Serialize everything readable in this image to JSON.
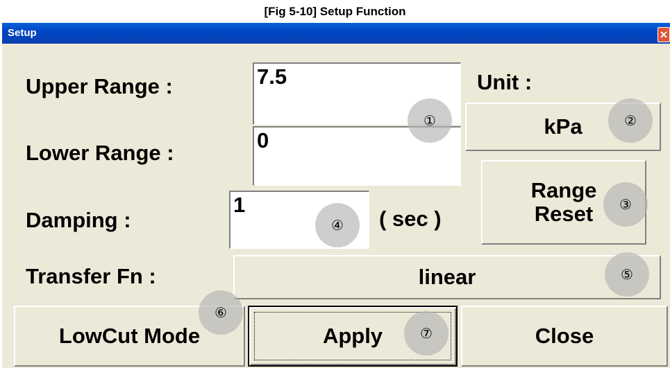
{
  "caption": "[Fig 5-10] Setup Function",
  "window": {
    "title": "Setup",
    "close_glyph": "✕"
  },
  "labels": {
    "upper_range": "Upper Range :",
    "lower_range": "Lower Range :",
    "damping": "Damping :",
    "damping_unit": "( sec )",
    "transfer_fn": "Transfer Fn :",
    "unit": "Unit :"
  },
  "fields": {
    "upper_range_value": "7.5",
    "lower_range_value": "0",
    "damping_value": "1"
  },
  "buttons": {
    "unit": "kPa",
    "range_reset": "Range\nReset",
    "transfer_fn": "linear",
    "lowcut_mode": "LowCut Mode",
    "apply": "Apply",
    "close": "Close"
  },
  "markers": {
    "m1": "①",
    "m2": "②",
    "m3": "③",
    "m4": "④",
    "m5": "⑤",
    "m6": "⑥",
    "m7": "⑦"
  },
  "colors": {
    "titlebar": "#0046c4",
    "window_bg": "#ece9d8",
    "close_button": "#e0553a"
  }
}
